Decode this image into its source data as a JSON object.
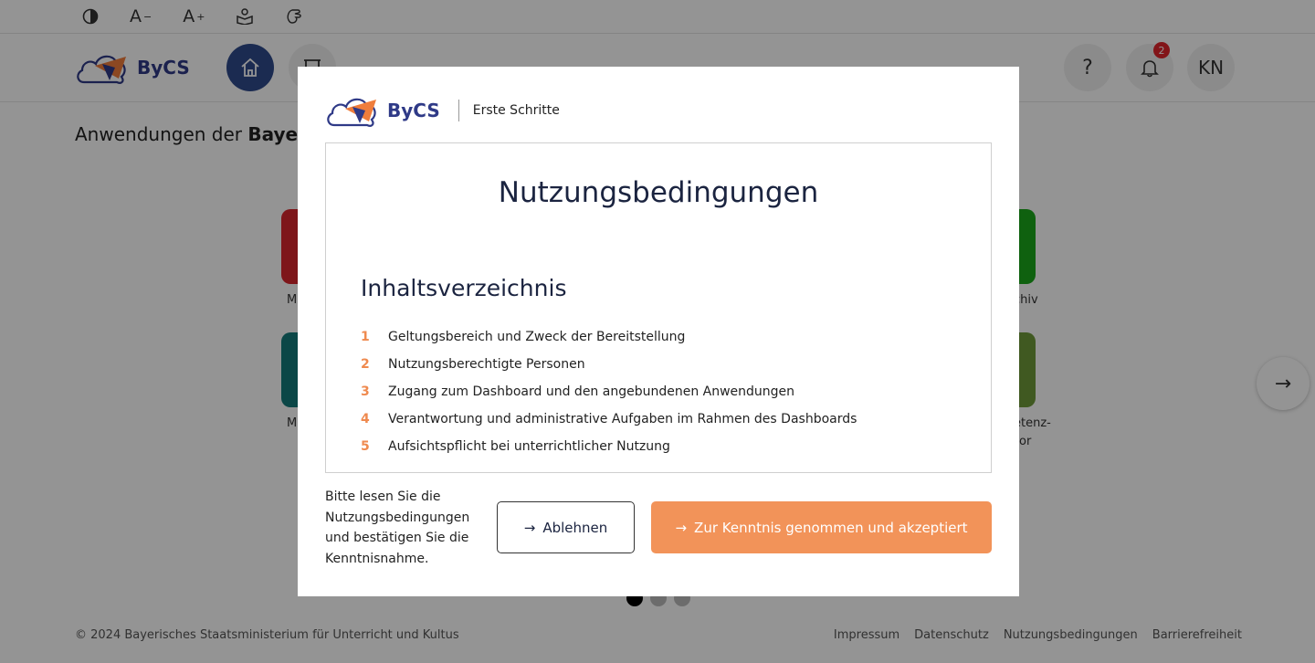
{
  "a11y_bar": {
    "contrast_icon": "contrast-icon",
    "font_smaller_label": "A",
    "font_smaller_sign": "−",
    "font_larger_label": "A",
    "font_larger_sign": "+",
    "reading_icon": "reading-icon",
    "sign_language_icon": "sign-language-icon"
  },
  "header": {
    "logo_text": "ByCS",
    "help_label": "?",
    "notifications_count": "2",
    "avatar_initials": "KN"
  },
  "page": {
    "section_title_prefix": "Anwendungen der ",
    "section_title_bold": "Bayer",
    "tile_labels": [
      "M",
      "M",
      "chiv",
      "etenz-",
      "or"
    ]
  },
  "footer": {
    "copyright": "© 2024 Bayerisches Staatsministerium für Unterricht und Kultus",
    "links": [
      "Impressum",
      "Datenschutz",
      "Nutzungsbedingungen",
      "Barrierefreiheit"
    ]
  },
  "modal": {
    "logo_text": "ByCS",
    "subtitle": "Erste Schritte",
    "terms_title": "Nutzungsbedingungen",
    "toc_title": "Inhaltsverzeichnis",
    "toc_items": [
      {
        "num": "1",
        "text": "Geltungsbereich und Zweck der Bereitstellung"
      },
      {
        "num": "2",
        "text": "Nutzungsberechtigte Personen"
      },
      {
        "num": "3",
        "text": "Zugang zum Dashboard und den angebundenen Anwendungen"
      },
      {
        "num": "4",
        "text": "Verantwortung und administrative Aufgaben im Rahmen des Dashboards"
      },
      {
        "num": "5",
        "text": "Aufsichtspflicht bei unterrichtlicher Nutzung"
      }
    ],
    "notice": "Bitte lesen Sie die Nutzungsbedingungen und bestätigen Sie die Kenntnisnahme.",
    "decline_label": "Ablehnen",
    "accept_label": "Zur Kenntnis genommen und akzeptiert"
  },
  "colors": {
    "accent_orange": "#f29359",
    "brand_blue": "#2f3a87",
    "home_blue": "#2f4b8c",
    "badge_red": "#e0252b"
  }
}
